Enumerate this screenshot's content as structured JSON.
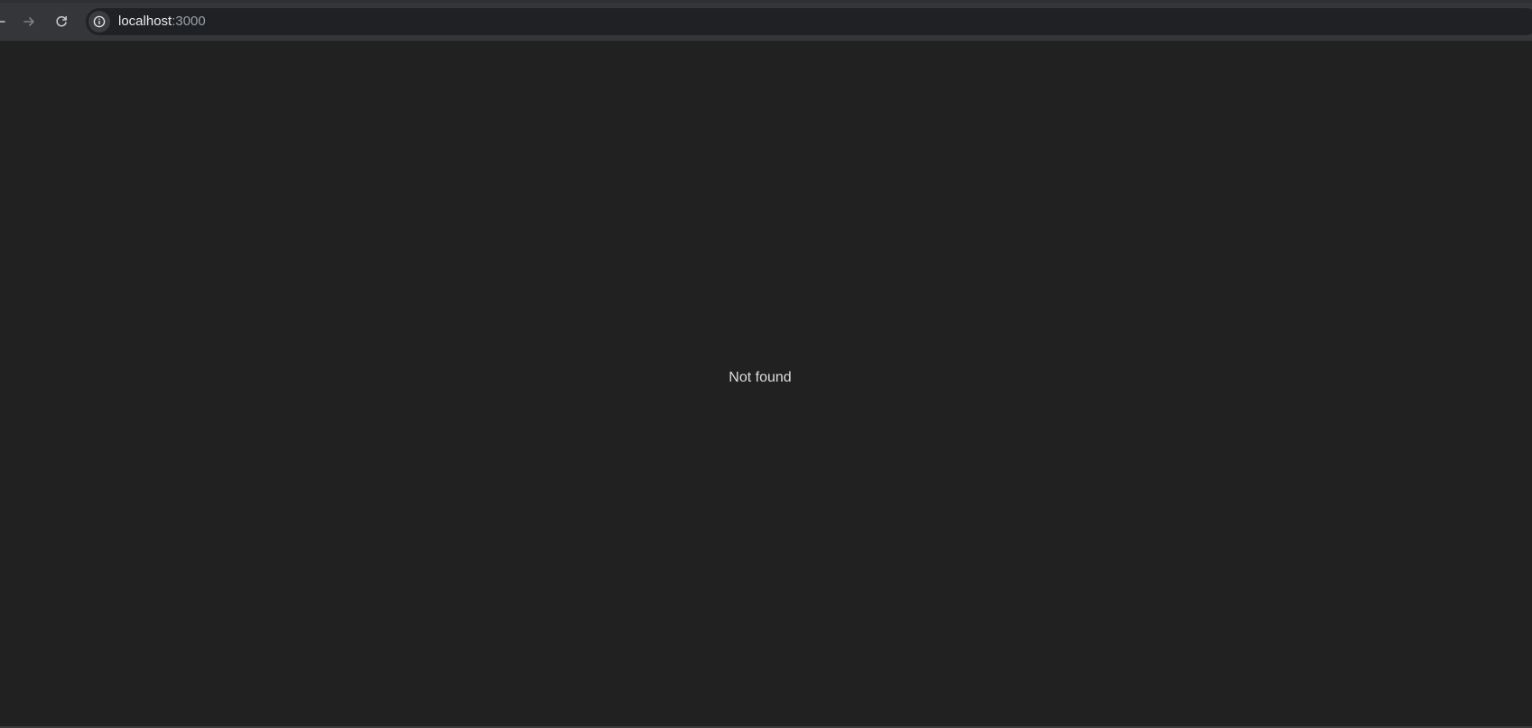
{
  "browser": {
    "toolbar": {
      "back_icon": "arrow-left-icon",
      "forward_icon": "arrow-right-icon",
      "reload_icon": "reload-icon",
      "site_info_icon": "info-circle-icon"
    },
    "address_bar": {
      "host": "localhost",
      "port": ":3000"
    }
  },
  "page": {
    "message": "Not found"
  },
  "colors": {
    "toolbar": "#35363a",
    "omnibox": "#202124",
    "page_background": "#212121",
    "text": "#dedede"
  }
}
